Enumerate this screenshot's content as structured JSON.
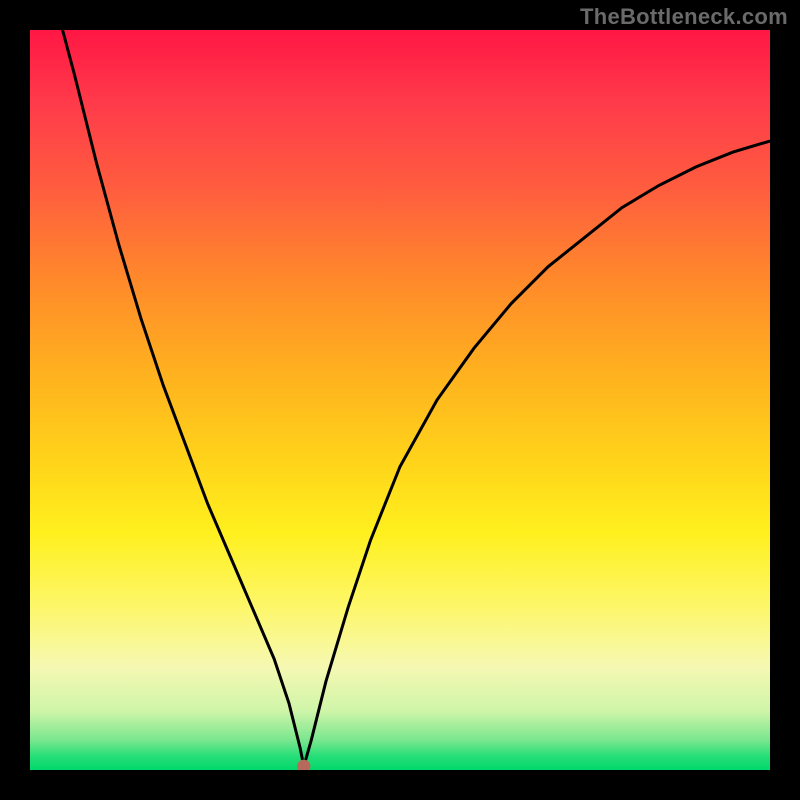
{
  "watermark": "TheBottleneck.com",
  "chart_data": {
    "type": "line",
    "title": "",
    "xlabel": "",
    "ylabel": "",
    "xlim": [
      0,
      100
    ],
    "ylim": [
      0,
      100
    ],
    "grid": false,
    "legend": false,
    "annotations": [],
    "marker": {
      "x": 37,
      "y": 0.5,
      "color": "#b86a5a",
      "radius_pct": 0.9
    },
    "series": [
      {
        "name": "bottleneck-curve",
        "x": [
          3.6,
          6,
          9,
          12,
          15,
          18,
          21,
          24,
          27,
          30,
          33,
          35,
          36.5,
          37,
          38,
          40,
          43,
          46,
          50,
          55,
          60,
          65,
          70,
          75,
          80,
          85,
          90,
          95,
          100
        ],
        "y": [
          103,
          94,
          82,
          71,
          61,
          52,
          44,
          36,
          29,
          22,
          15,
          9,
          3,
          0.5,
          4,
          12,
          22,
          31,
          41,
          50,
          57,
          63,
          68,
          72,
          76,
          79,
          81.5,
          83.5,
          85
        ]
      }
    ],
    "colors": {
      "curve": "#000000",
      "background_top": "#ff1744",
      "background_bottom": "#00d86b",
      "frame": "#000000"
    }
  }
}
